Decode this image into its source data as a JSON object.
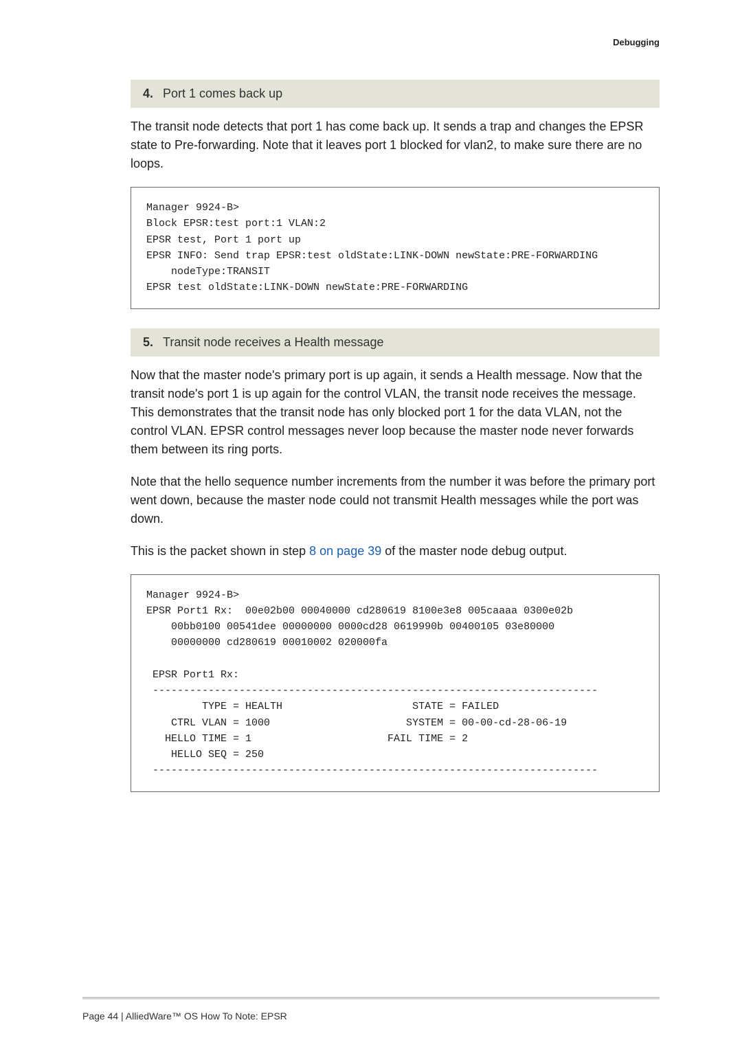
{
  "header": {
    "section": "Debugging"
  },
  "steps": [
    {
      "num": "4.",
      "title": "Port 1 comes back up",
      "paragraphs": [
        "The transit node detects that port 1 has come back up. It sends a trap and changes the EPSR state to Pre-forwarding. Note that it leaves port 1 blocked for vlan2, to make sure there are no loops."
      ],
      "code": "Manager 9924-B>\nBlock EPSR:test port:1 VLAN:2\nEPSR test, Port 1 port up\nEPSR INFO: Send trap EPSR:test oldState:LINK-DOWN newState:PRE-FORWARDING\n    nodeType:TRANSIT\nEPSR test oldState:LINK-DOWN newState:PRE-FORWARDING"
    },
    {
      "num": "5.",
      "title": "Transit node receives a Health message",
      "paragraphs": [
        "Now that the master node's primary port is up again, it sends a Health message. Now that the transit node's port 1 is up again for the control VLAN, the transit node receives the message. This demonstrates that the transit node has only blocked port 1 for the data VLAN, not the control VLAN. EPSR control messages never loop because the master node never forwards them between its ring ports.",
        "Note that the hello sequence number increments from the number it was before the primary port went down, because the master node could not transmit Health messages while the port was down."
      ],
      "xref_pre": "This is the packet shown in step ",
      "xref_link": "8 on page 39",
      "xref_post": " of the master node debug output.",
      "code": "Manager 9924-B>\nEPSR Port1 Rx:  00e02b00 00040000 cd280619 8100e3e8 005caaaa 0300e02b\n    00bb0100 00541dee 00000000 0000cd28 0619990b 00400105 03e80000\n    00000000 cd280619 00010002 020000fa\n\n EPSR Port1 Rx:\n ------------------------------------------------------------------------\n         TYPE = HEALTH                     STATE = FAILED\n    CTRL VLAN = 1000                      SYSTEM = 00-00-cd-28-06-19\n   HELLO TIME = 1                      FAIL TIME = 2\n    HELLO SEQ = 250\n ------------------------------------------------------------------------"
    }
  ],
  "footer": {
    "text": "Page 44 | AlliedWare™ OS How To Note: EPSR"
  }
}
